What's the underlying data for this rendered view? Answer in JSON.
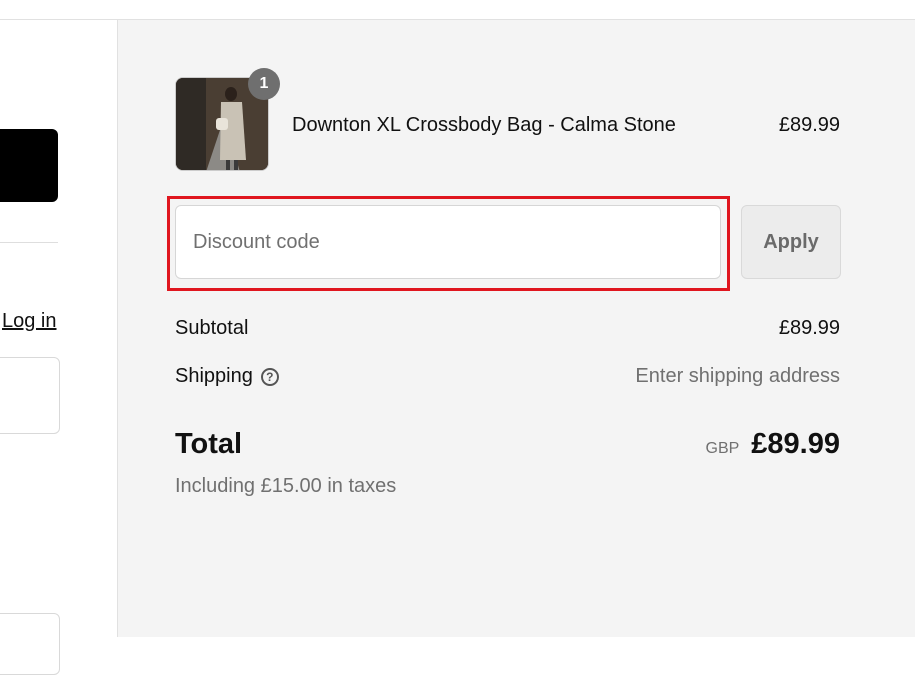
{
  "left": {
    "login_link": "Log in"
  },
  "order": {
    "item": {
      "name": "Downton XL Crossbody Bag - Calma Stone",
      "price": "£89.99",
      "quantity": "1",
      "image_icon": "product-photo-woman-with-bag"
    },
    "discount": {
      "placeholder": "Discount code",
      "value": "",
      "apply_label": "Apply",
      "highlight_color": "#e0161f"
    },
    "subtotal": {
      "label": "Subtotal",
      "value": "£89.99"
    },
    "shipping": {
      "label": "Shipping",
      "icon": "question-circle-icon",
      "value": "Enter shipping address"
    },
    "total": {
      "label": "Total",
      "currency": "GBP",
      "value": "£89.99",
      "taxes_note": "Including £15.00 in taxes"
    }
  }
}
